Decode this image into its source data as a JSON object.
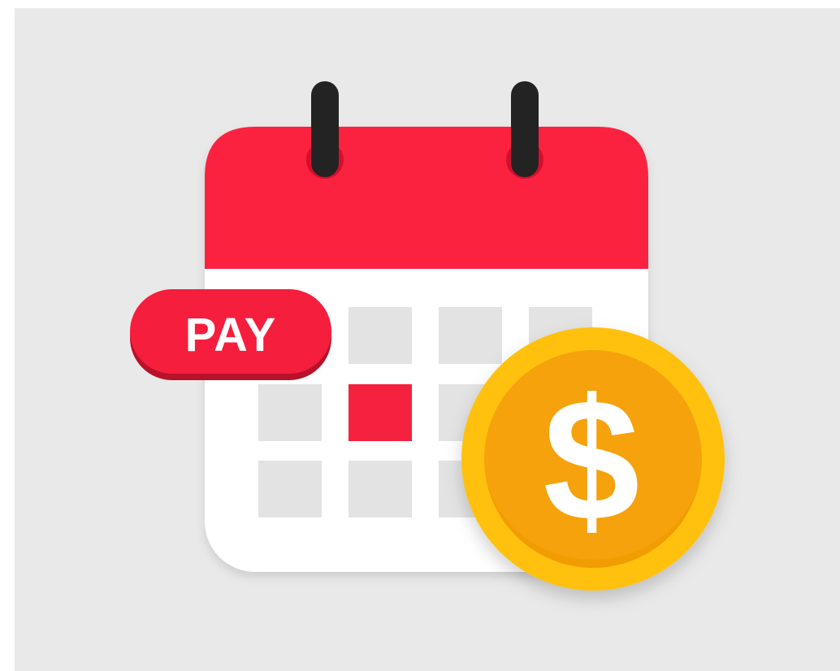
{
  "illustration": {
    "pay_badge_text": "PAY",
    "coin_symbol": "$",
    "icon_names": {
      "calendar": "calendar-icon",
      "binder_rings": "binder-ring-icon",
      "coin": "dollar-coin-icon"
    }
  },
  "colors": {
    "background": "#e9e9e9",
    "calendar_header": "#fb2340",
    "calendar_body": "#ffffff",
    "grid_cell": "#e3e3e3",
    "highlight_cell": "#f4223f",
    "ring": "#232323",
    "coin_outer": "#ffc10d",
    "coin_inner": "#f5a207",
    "symbol": "#ffffff"
  }
}
